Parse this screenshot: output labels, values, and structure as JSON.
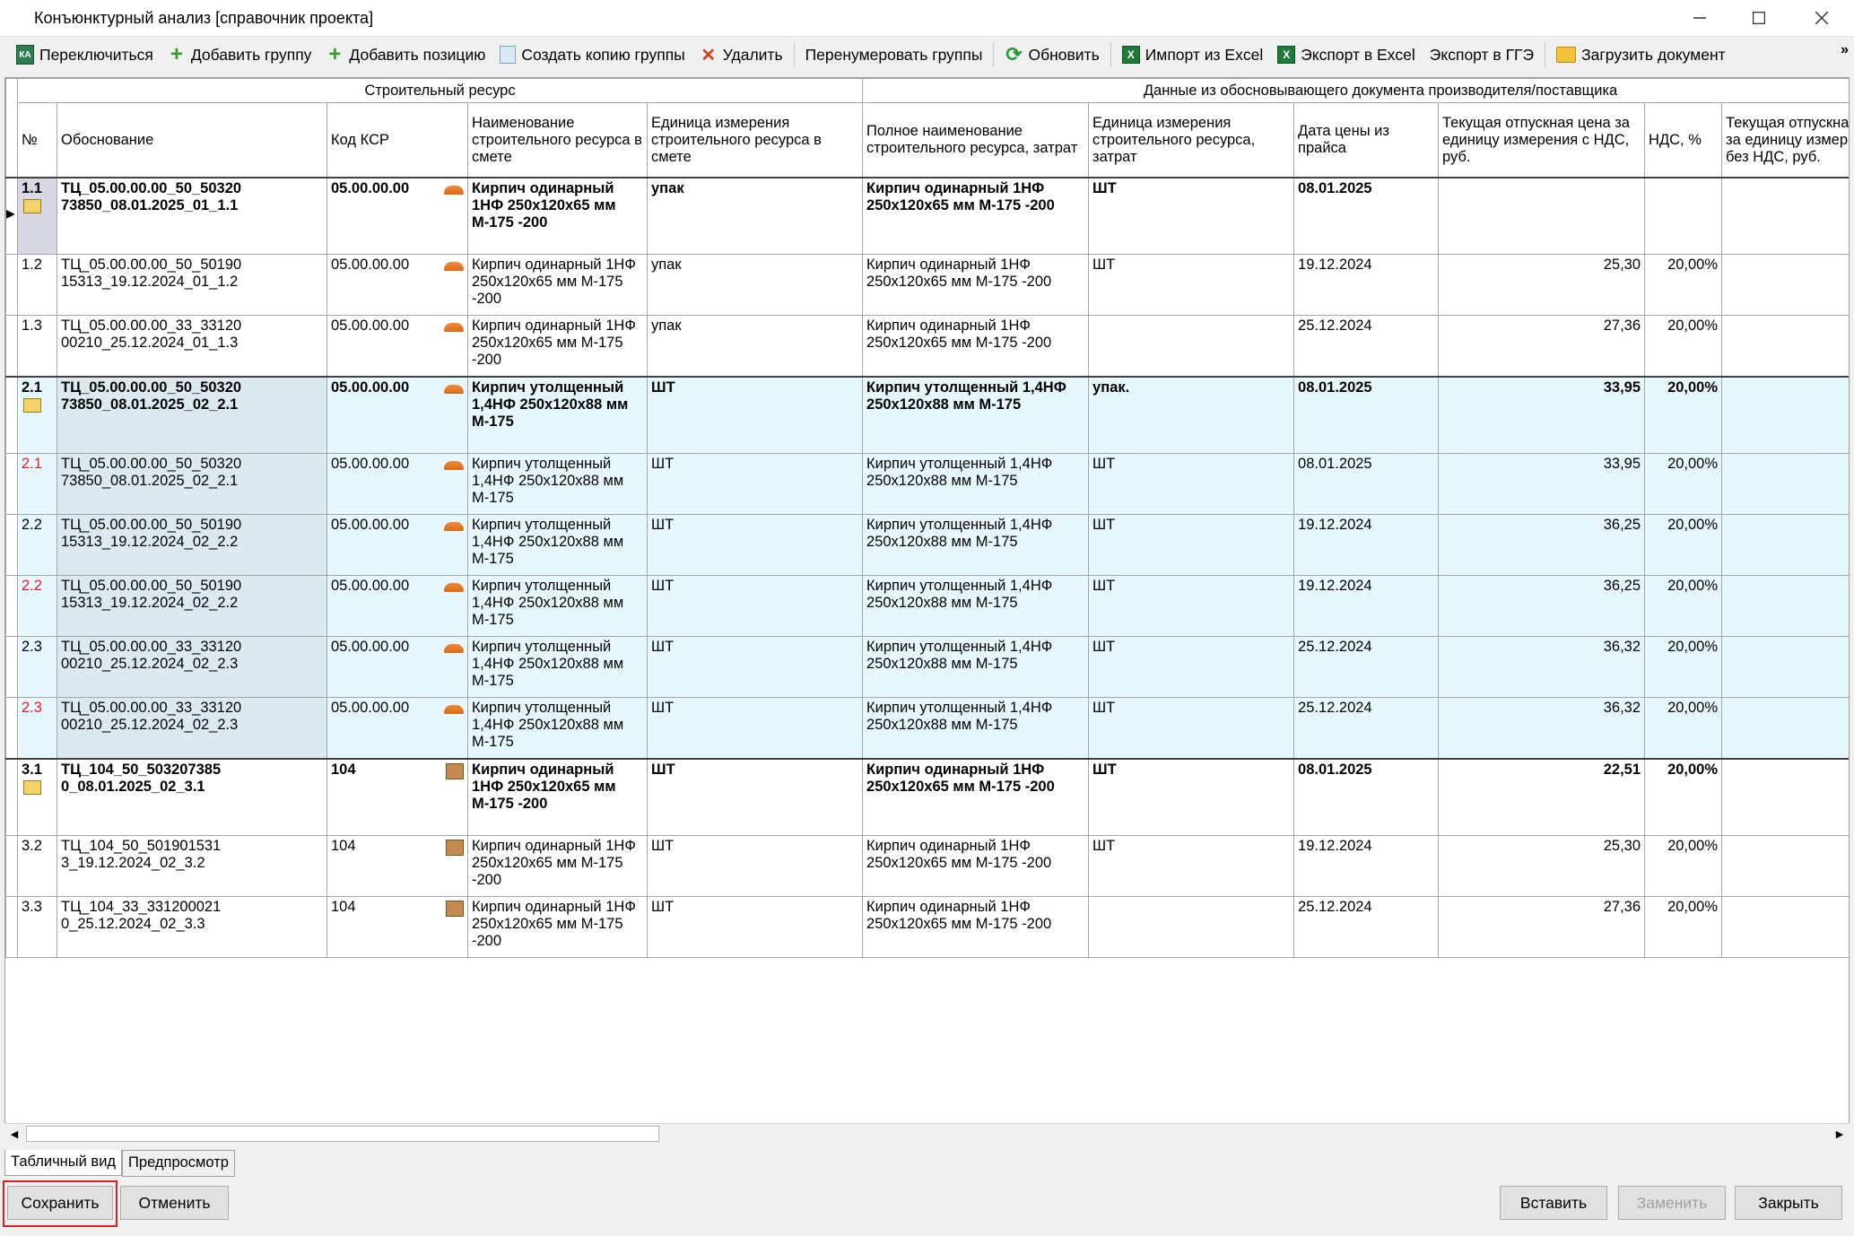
{
  "window": {
    "title": "Конъюнктурный анализ [справочник проекта]"
  },
  "toolbar": {
    "switch": "Переключиться",
    "add_group": "Добавить группу",
    "add_position": "Добавить позицию",
    "copy_group": "Создать копию группы",
    "delete": "Удалить",
    "renumber": "Перенумеровать группы",
    "refresh": "Обновить",
    "import_excel": "Импорт из Excel",
    "export_excel": "Экспорт в Excel",
    "export_gge": "Экспорт в ГГЭ",
    "load_doc": "Загрузить документ",
    "more": "»"
  },
  "table": {
    "group_headers": [
      "Строительный ресурс",
      "Данные из обосновывающего документа производителя/поставщика"
    ],
    "headers": [
      "№",
      "Обоснование",
      "Код КСР",
      "Наименование строительного ресурса в смете",
      "Единица измерения строительного ресурса в смете",
      "Полное наименование строительного ресурса, затрат",
      "Единица измерения строительного ресурса, затрат",
      "Дата цены из прайса",
      "Текущая отпускная цена за единицу измерения с НДС, руб.",
      "НДС, %",
      "Текущая отпускная цена за единицу измерения без НДС, руб."
    ],
    "rows": [
      {
        "num": "1.1",
        "just": "ТЦ_05.00.00.00_50_50320 73850_08.01.2025_01_1.1",
        "code": "05.00.00.00",
        "name": "Кирпич одинарный 1НФ 250х120х65 мм М-175 -200",
        "unit": "упак",
        "full": "Кирпич одинарный 1НФ 250х120х65 мм М-175 -200",
        "unit2": "ШТ",
        "date": "08.01.2025",
        "price": "",
        "vat": ""
      },
      {
        "num": "1.2",
        "just": "ТЦ_05.00.00.00_50_50190 15313_19.12.2024_01_1.2",
        "code": "05.00.00.00",
        "name": "Кирпич одинарный 1НФ 250х120х65 мм М-175 -200",
        "unit": "упак",
        "full": "Кирпич одинарный 1НФ 250х120х65 мм М-175 -200",
        "unit2": "ШТ",
        "date": "19.12.2024",
        "price": "25,30",
        "vat": "20,00%"
      },
      {
        "num": "1.3",
        "just": "ТЦ_05.00.00.00_33_33120 00210_25.12.2024_01_1.3",
        "code": "05.00.00.00",
        "name": "Кирпич одинарный 1НФ 250х120х65 мм М-175 -200",
        "unit": "упак",
        "full": "Кирпич одинарный 1НФ 250х120х65 мм М-175 -200",
        "unit2": "",
        "date": "25.12.2024",
        "price": "27,36",
        "vat": "20,00%"
      },
      {
        "num": "2.1",
        "just": "ТЦ_05.00.00.00_50_50320 73850_08.01.2025_02_2.1",
        "code": "05.00.00.00",
        "name": "Кирпич утолщенный 1,4НФ 250х120х88 мм М-175",
        "unit": "ШТ",
        "full": "Кирпич утолщенный 1,4НФ 250х120х88 мм М-175",
        "unit2": "упак.",
        "date": "08.01.2025",
        "price": "33,95",
        "vat": "20,00%"
      },
      {
        "num": "2.1",
        "just": "ТЦ_05.00.00.00_50_50320 73850_08.01.2025_02_2.1",
        "code": "05.00.00.00",
        "name": "Кирпич утолщенный 1,4НФ 250х120х88 мм М-175",
        "unit": "ШТ",
        "full": "Кирпич утолщенный 1,4НФ 250х120х88 мм М-175",
        "unit2": "ШТ",
        "date": "08.01.2025",
        "price": "33,95",
        "vat": "20,00%"
      },
      {
        "num": "2.2",
        "just": "ТЦ_05.00.00.00_50_50190 15313_19.12.2024_02_2.2",
        "code": "05.00.00.00",
        "name": "Кирпич утолщенный 1,4НФ 250х120х88 мм М-175",
        "unit": "ШТ",
        "full": "Кирпич утолщенный 1,4НФ 250х120х88 мм М-175",
        "unit2": "ШТ",
        "date": "19.12.2024",
        "price": "36,25",
        "vat": "20,00%"
      },
      {
        "num": "2.2",
        "just": "ТЦ_05.00.00.00_50_50190 15313_19.12.2024_02_2.2",
        "code": "05.00.00.00",
        "name": "Кирпич утолщенный 1,4НФ 250х120х88 мм М-175",
        "unit": "ШТ",
        "full": "Кирпич утолщенный 1,4НФ 250х120х88 мм М-175",
        "unit2": "ШТ",
        "date": "19.12.2024",
        "price": "36,25",
        "vat": "20,00%"
      },
      {
        "num": "2.3",
        "just": "ТЦ_05.00.00.00_33_33120 00210_25.12.2024_02_2.3",
        "code": "05.00.00.00",
        "name": "Кирпич утолщенный 1,4НФ 250х120х88 мм М-175",
        "unit": "ШТ",
        "full": "Кирпич утолщенный 1,4НФ 250х120х88 мм М-175",
        "unit2": "ШТ",
        "date": "25.12.2024",
        "price": "36,32",
        "vat": "20,00%"
      },
      {
        "num": "2.3",
        "just": "ТЦ_05.00.00.00_33_33120 00210_25.12.2024_02_2.3",
        "code": "05.00.00.00",
        "name": "Кирпич утолщенный 1,4НФ 250х120х88 мм М-175",
        "unit": "ШТ",
        "full": "Кирпич утолщенный 1,4НФ 250х120х88 мм М-175",
        "unit2": "ШТ",
        "date": "25.12.2024",
        "price": "36,32",
        "vat": "20,00%"
      },
      {
        "num": "3.1",
        "just": "ТЦ_104_50_503207385 0_08.01.2025_02_3.1",
        "code": "104",
        "name": "Кирпич одинарный 1НФ 250х120х65 мм М-175 -200",
        "unit": "ШТ",
        "full": "Кирпич одинарный 1НФ 250х120х65 мм М-175 -200",
        "unit2": "ШТ",
        "date": "08.01.2025",
        "price": "22,51",
        "vat": "20,00%"
      },
      {
        "num": "3.2",
        "just": "ТЦ_104_50_501901531 3_19.12.2024_02_3.2",
        "code": "104",
        "name": "Кирпич одинарный 1НФ 250х120х65 мм М-175 -200",
        "unit": "ШТ",
        "full": "Кирпич одинарный 1НФ 250х120х65 мм М-175 -200",
        "unit2": "ШТ",
        "date": "19.12.2024",
        "price": "25,30",
        "vat": "20,00%"
      },
      {
        "num": "3.3",
        "just": "ТЦ_104_33_331200021 0_25.12.2024_02_3.3",
        "code": "104",
        "name": "Кирпич одинарный 1НФ 250х120х65 мм М-175 -200",
        "unit": "ШТ",
        "full": "Кирпич одинарный 1НФ 250х120х65 мм М-175 -200",
        "unit2": "",
        "date": "25.12.2024",
        "price": "27,36",
        "vat": "20,00%"
      }
    ]
  },
  "tabs": {
    "table_view": "Табличный вид",
    "preview": "Предпросмотр"
  },
  "buttons": {
    "save": "Сохранить",
    "cancel": "Отменить",
    "insert": "Вставить",
    "replace": "Заменить",
    "close": "Закрыть"
  },
  "colors": {
    "group_bg": "#e6f7fd",
    "highlight_border": "#e02020",
    "red_number": "#e02020"
  }
}
